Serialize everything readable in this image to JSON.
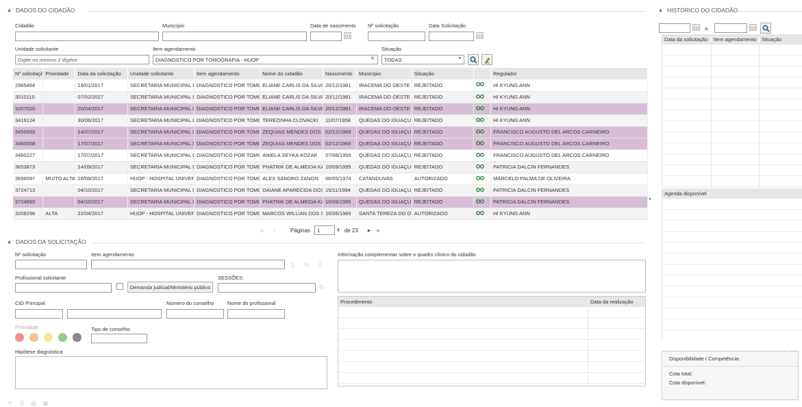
{
  "cidadao": {
    "title": "DADOS DO CIDADÃO",
    "labels": {
      "cidadao": "Cidadão",
      "municipio": "Município",
      "nascimento": "Data de nascimento",
      "nsol": "Nº solicitação",
      "datasol": "Data Solicitação",
      "unidade": "Unidade solicitante",
      "item": "Item agendamento",
      "situacao": "Situação"
    },
    "unidade_placeholder": "Digite no mínimo 2 dígitos",
    "item_value": "DIAGNOSTICO POR TOMOGRAFIA - HUOP",
    "situacao_value": "TODAS",
    "clear_glyph": "×",
    "headers": [
      "Nº solicitação",
      "Prioridade",
      "Data da solicitação",
      "Unidade solicitante",
      "Item agendamento",
      "Nome do cidadão",
      "Nascimento",
      "Município",
      "Situação",
      "",
      "Regulador"
    ],
    "rows": [
      [
        "2965464",
        "",
        "18/01/2017",
        "SECRETARIA MUNICIPAL DE SAUDE",
        "DIAGNOSTICO POR TOMOGRAFIA",
        "ELIANE CARLIS DA SILVA",
        "20/12/1981",
        "IRACEMA DO OESTE",
        "REJEITADO",
        "HI KYUNG ANN"
      ],
      [
        "3010110",
        "",
        "07/02/2017",
        "SECRETARIA MUNICIPAL DE SAUDE",
        "DIAGNOSTICO POR TOMOGRAFIA",
        "ELIANE CARLIS DA SILVA",
        "20/12/1981",
        "IRACEMA DO OESTE",
        "REJEITADO",
        "HI KYUNG ANN"
      ],
      [
        "3207020",
        "",
        "20/04/2017",
        "SECRETARIA MUNICIPAL DE SAUDE",
        "DIAGNOSTICO POR TOMOGRAFIA",
        "ELIANE CARLIS DA SILVA",
        "20/12/1981",
        "IRACEMA DO OESTE",
        "REJEITADO",
        "HI KYUNG ANN"
      ],
      [
        "3416124",
        "",
        "30/06/2017",
        "SECRETARIA MUNICIPAL DE SAUDE",
        "DIAGNOSTICO POR TOMOGRAFIA",
        "TEREZINHA CLOVACKI",
        "11/07/1958",
        "QUEDAS DO IGUAÇU",
        "REJEITADO",
        "HI KYUNG ANN"
      ],
      [
        "3455693",
        "",
        "14/07/2017",
        "SECRETARIA MUNICIPAL DE SAUDE",
        "DIAGNOSTICO POR TOMOGRAFIA",
        "ZEQUIAS MENDES DOS SANTOS",
        "02/12/1968",
        "QUEDAS DO IGUAÇU",
        "REJEITADO",
        "FRANCISCO AUGUSTO DEL ARCOS CARNEIRO"
      ],
      [
        "3460058",
        "",
        "17/07/2017",
        "SECRETARIA MUNICIPAL DE SAUDE",
        "DIAGNOSTICO POR TOMOGRAFIA",
        "ZEQUIAS MENDES DOS SANTOS",
        "02/12/1968",
        "QUEDAS DO IGUAÇU",
        "REJEITADO",
        "FRANCISCO AUGUSTO DEL ARCOS CARNEIRO"
      ],
      [
        "3460227",
        "",
        "17/07/2017",
        "SECRETARIA MUNICIPAL DE SAUDE",
        "DIAGNOSTICO POR TOMOGRAFIA",
        "ANIELA SEYKA KOZAK",
        "07/08/1959",
        "QUEDAS DO IGUAÇU",
        "REJEITADO",
        "FRANCISCO AUGUSTO DEL ARCOS CARNEIRO"
      ],
      [
        "3653873",
        "",
        "14/09/2017",
        "SECRETARIA MUNICIPAL DE SAUDE",
        "DIAGNOSTICO POR TOMOGRAFIA",
        "PHATRIK DE ALMEIDA KAWAKAMI",
        "10/09/1995",
        "QUEDAS DO IGUAÇU",
        "REJEITADO",
        "PATRICIA DALCIN FERNANDES"
      ],
      [
        "3696097",
        "MUITO ALTA",
        "26/09/2017",
        "HUOP - HOSPITAL UNIVERSITARIO",
        "DIAGNOSTICO POR TOMOGRAFIA",
        "ALEX SANDRO ZANON",
        "06/05/1974",
        "CATANDUVAS",
        "AUTORIZADO",
        "MARCELO PALMA DE OLIVEIRA"
      ],
      [
        "3724713",
        "",
        "04/10/2017",
        "SECRETARIA MUNICIPAL DE SAUDE",
        "DIAGNOSTICO POR TOMOGRAFIA",
        "DAIANE APARECIDA DOS SANTOS",
        "15/11/1994",
        "QUEDAS DO IGUAÇU",
        "REJEITADO",
        "PATRICIA DALCIN FERNANDES"
      ],
      [
        "3724993",
        "",
        "04/10/2017",
        "SECRETARIA MUNICIPAL DE SAUDE",
        "DIAGNOSTICO POR TOMOGRAFIA",
        "PHATRIK DE ALMEIDA KAWAKAMI",
        "10/09/1995",
        "QUEDAS DO IGUAÇU",
        "REJEITADO",
        "PATRICIA DALCIN FERNANDES"
      ],
      [
        "3208296",
        "ALTA",
        "22/04/2017",
        "HUOP - HOSPITAL UNIVERSITARIO",
        "DIAGNOSTICO POR TOMOGRAFIA",
        "MARCOS WILLIAN DOS SANTOS",
        "16/06/1989",
        "SANTA TEREZA DO OESTE",
        "AUTORIZADO",
        "HI KYUNG ANN"
      ]
    ],
    "highlight": [
      false,
      false,
      true,
      false,
      true,
      true,
      false,
      false,
      false,
      false,
      true,
      false
    ],
    "pager": {
      "label": "Páginas",
      "page": "1",
      "of": "de 23"
    }
  },
  "solicitacao": {
    "title": "DADOS DA SOLICITAÇÃO",
    "labels": {
      "nsol": "Nº solicitação",
      "item": "Item agendamento",
      "info": "Informação complementar sobre o quadro clínico do cidadão",
      "prof": "Profissional solicitante",
      "sessoes": "SESSÕES:",
      "cid": "CID Principal",
      "nconselho": "Número do conselho",
      "nomeprof": "Nome do profissional",
      "prioridade": "Prioridade",
      "tipoconselho": "Tipo de conselho",
      "hipotese": "Hipótese diagnóstica"
    },
    "demanda_button": "Demanda judicial/Ministério público",
    "proc_headers": [
      "Procedimento",
      "Data da realização"
    ],
    "priority_colors": [
      "#f08f8f",
      "#f7c08f",
      "#f7e58f",
      "#8fcf8f",
      "#888888"
    ]
  },
  "historico": {
    "title": "HISTÓRICO DO CIDADÃO",
    "a": "a",
    "headers": [
      "Data da solicitação",
      "Item agendamento",
      "Situação"
    ],
    "agenda": "Agenda disponível",
    "disp": {
      "title": "Disponibilidade / Competência:",
      "cota_total": "Cota total:",
      "cota_disp": "Cota disponível:"
    }
  }
}
